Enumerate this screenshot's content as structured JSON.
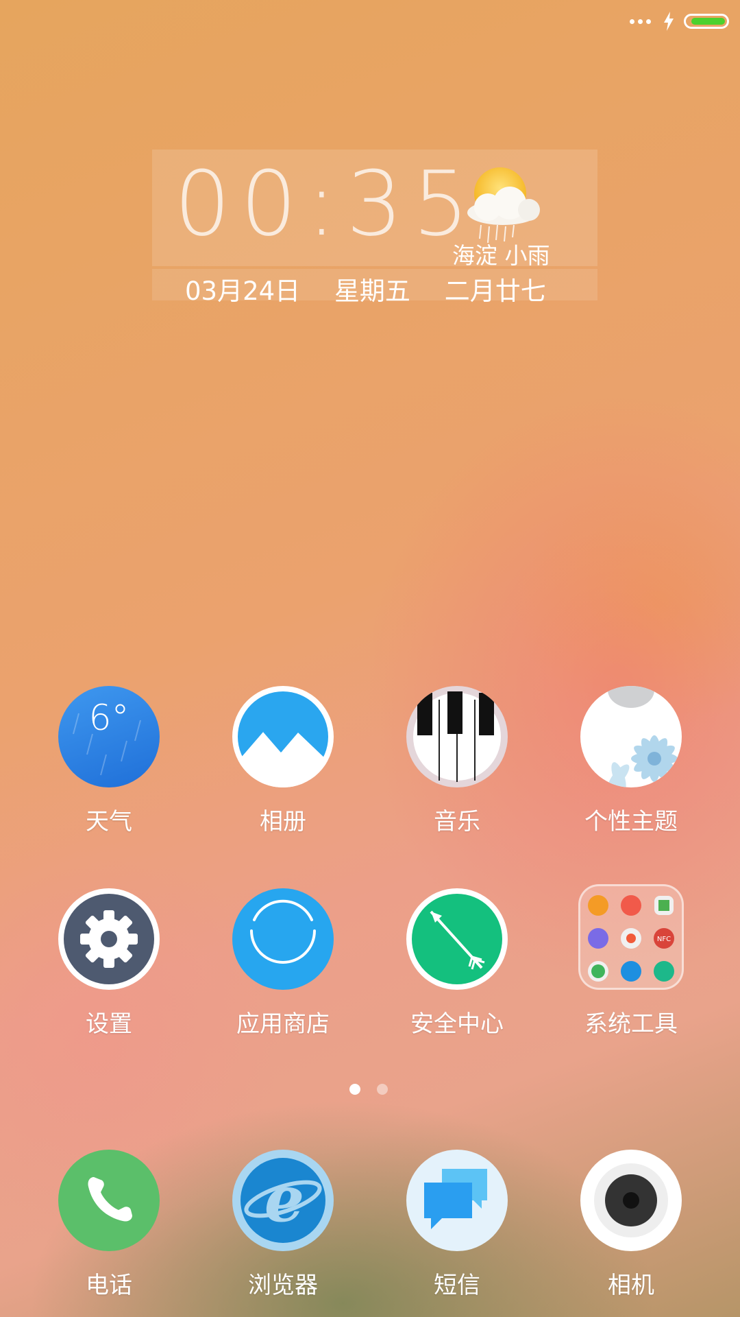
{
  "status_bar": {
    "more_icon": "more-dots-icon",
    "charging_icon": "charging-bolt-icon",
    "battery_level": 0.9,
    "battery_color": "#4bd12e"
  },
  "clock_widget": {
    "time": "00:35",
    "location_weather": "海淀 小雨",
    "date": "03月24日",
    "weekday": "星期五",
    "lunar_date": "二月廿七",
    "weather_icon": "sun-cloud-rain-icon"
  },
  "apps": [
    {
      "label": "天气",
      "icon": "weather-icon",
      "icon_text": "6°"
    },
    {
      "label": "相册",
      "icon": "gallery-icon"
    },
    {
      "label": "音乐",
      "icon": "music-piano-icon"
    },
    {
      "label": "个性主题",
      "icon": "themes-icon"
    },
    {
      "label": "设置",
      "icon": "settings-gear-icon"
    },
    {
      "label": "应用商店",
      "icon": "app-store-icon"
    },
    {
      "label": "安全中心",
      "icon": "security-center-icon"
    },
    {
      "label": "系统工具",
      "icon": "system-tools-folder-icon"
    }
  ],
  "pager": {
    "pages": 2,
    "current": 1
  },
  "dock": [
    {
      "label": "电话",
      "icon": "phone-icon"
    },
    {
      "label": "浏览器",
      "icon": "browser-icon"
    },
    {
      "label": "短信",
      "icon": "messages-icon"
    },
    {
      "label": "相机",
      "icon": "camera-icon"
    }
  ],
  "colors": {
    "phone": "#5bbf6a",
    "browser": "#1a86d0",
    "security": "#14c07e",
    "app_store": "#27a6ef",
    "settings": "#4e5a70",
    "weather": "#2b86e8"
  }
}
